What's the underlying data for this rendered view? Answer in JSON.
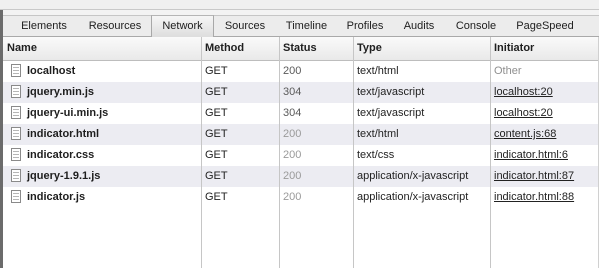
{
  "tabs": [
    {
      "label": "Elements"
    },
    {
      "label": "Resources"
    },
    {
      "label": "Network",
      "active": true
    },
    {
      "label": "Sources"
    },
    {
      "label": "Timeline"
    },
    {
      "label": "Profiles"
    },
    {
      "label": "Audits"
    },
    {
      "label": "Console"
    },
    {
      "label": "PageSpeed"
    }
  ],
  "columns": {
    "name": "Name",
    "method": "Method",
    "status": "Status",
    "type": "Type",
    "initiator": "Initiator"
  },
  "rows": [
    {
      "name": "localhost",
      "method": "GET",
      "status": "200",
      "type": "text/html",
      "initiator": "Other"
    },
    {
      "name": "jquery.min.js",
      "method": "GET",
      "status": "304",
      "type": "text/javascript",
      "initiator": "localhost:20"
    },
    {
      "name": "jquery-ui.min.js",
      "method": "GET",
      "status": "304",
      "type": "text/javascript",
      "initiator": "localhost:20"
    },
    {
      "name": "indicator.html",
      "method": "GET",
      "status": "200",
      "type": "text/html",
      "initiator": "content.js:68"
    },
    {
      "name": "indicator.css",
      "method": "GET",
      "status": "200",
      "type": "text/css",
      "initiator": "indicator.html:6"
    },
    {
      "name": "jquery-1.9.1.js",
      "method": "GET",
      "status": "200",
      "type": "application/x-javascript",
      "initiator": "indicator.html:87"
    },
    {
      "name": "indicator.js",
      "method": "GET",
      "status": "200",
      "type": "application/x-javascript",
      "initiator": "indicator.html:88"
    }
  ],
  "icons": {
    "file": "file-icon"
  }
}
